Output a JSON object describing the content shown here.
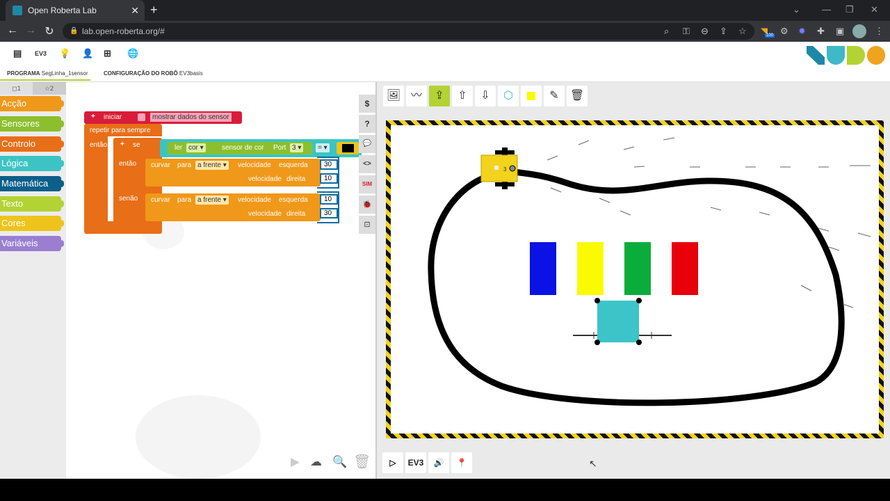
{
  "browser": {
    "tab_title": "Open Roberta Lab",
    "url": "lab.open-roberta.org/#",
    "extension_badge": "100"
  },
  "app": {
    "menu": {
      "ev3_label": "EV3"
    },
    "tabs": {
      "program_prefix": "PROGRAMA",
      "program_name": "SegLinha_1sensor",
      "config_prefix": "CONFIGURAÇÃO DO ROBÔ",
      "config_name": "EV3basis"
    },
    "logo_colors": [
      "#1e88a8",
      "#3fb8c8",
      "#b3d234",
      "#f0a31f"
    ]
  },
  "toolbox": {
    "tabs": [
      "1",
      "2"
    ],
    "categories": [
      {
        "label": "Acção",
        "color": "#f09819"
      },
      {
        "label": "Sensores",
        "color": "#8cbf2e"
      },
      {
        "label": "Controlo",
        "color": "#e86e18"
      },
      {
        "label": "Lógica",
        "color": "#3cc4c4"
      },
      {
        "label": "Matemática",
        "color": "#0b5f8a"
      },
      {
        "label": "Texto",
        "color": "#b3d234"
      },
      {
        "label": "Cores",
        "color": "#eec41c"
      },
      {
        "label": "Variáveis",
        "color": "#9a7fd1"
      }
    ]
  },
  "program": {
    "start_block": {
      "label": "iniciar",
      "show_sensor": "mostrar dados do sensor"
    },
    "loop_label": "repetir para sempre",
    "do_label": "então",
    "if_label": "se",
    "then_label": "então",
    "else_label": "senão",
    "condition": {
      "read": "ler",
      "mode": "cor",
      "sensor": "sensor de cor",
      "port_label": "Port",
      "port": "3",
      "op": "="
    },
    "then_action": {
      "verb": "curvar",
      "dir_label": "para",
      "direction": "a frente",
      "speed_left_label": "velocidade",
      "left": "esquerda",
      "speed_right_label": "velocidade",
      "right": "direita",
      "left_value": "30",
      "right_value": "10"
    },
    "else_action": {
      "verb": "curvar",
      "dir_label": "para",
      "direction": "a frente",
      "speed_left_label": "velocidade",
      "left": "esquerda",
      "speed_right_label": "velocidade",
      "right": "direita",
      "left_value": "10",
      "right_value": "30"
    }
  },
  "side_buttons": [
    "$",
    "?",
    "💬",
    "<>",
    "SIM",
    "🐞",
    "⊡"
  ],
  "simulation": {
    "bottom_buttons": [
      "▷",
      "EV3",
      "🔊",
      "📍"
    ],
    "robot_port_label": "3",
    "color_blocks": [
      "#0a12e6",
      "#fbfb00",
      "#0aad3c",
      "#e8000b"
    ],
    "obstacle_color": "#3cc4c8"
  }
}
